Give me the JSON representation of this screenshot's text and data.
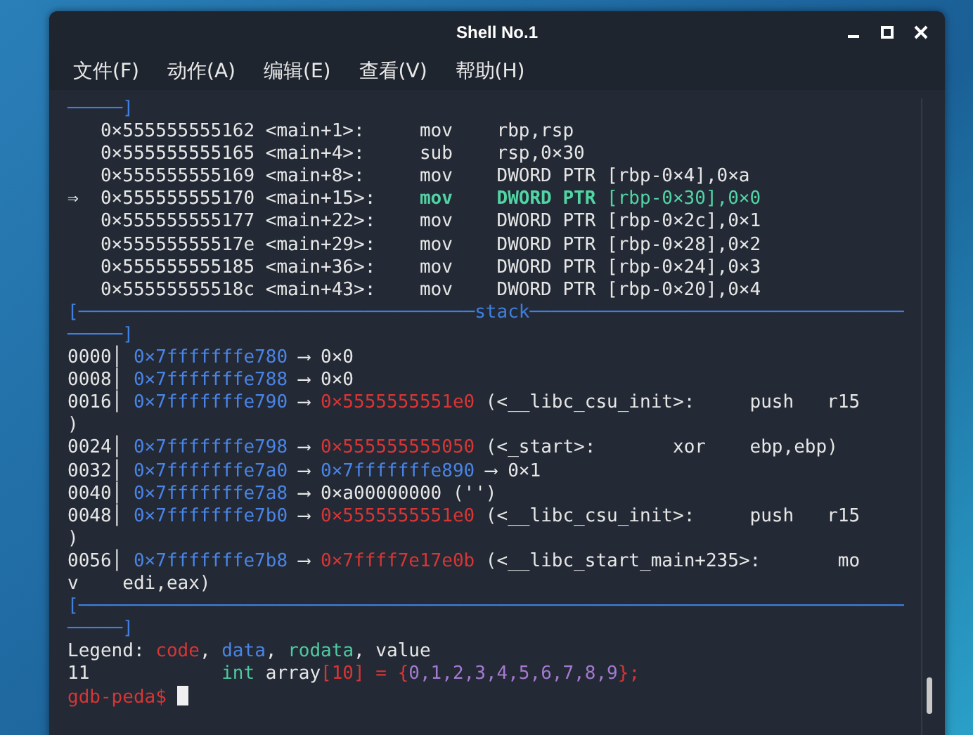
{
  "window": {
    "title": "Shell No.1"
  },
  "menu": [
    "文件(F)",
    "动作(A)",
    "编辑(E)",
    "查看(V)",
    "帮助(H)"
  ],
  "terminal_lines": [
    [
      {
        "text": "─────]",
        "kind": "frame"
      }
    ],
    [
      {
        "text": "   0×555555555162 <main+1>:     mov    rbp,rsp",
        "kind": "plain"
      }
    ],
    [
      {
        "text": "   0×555555555165 <main+4>:     sub    rsp,0×30",
        "kind": "plain"
      }
    ],
    [
      {
        "text": "   0×555555555169 <main+8>:     mov    DWORD PTR [rbp-0×4],0×a",
        "kind": "plain"
      }
    ],
    [
      {
        "text": "⇒  0×555555555170 <main+15>:    ",
        "kind": "plain"
      },
      {
        "text": "mov    DWORD PTR ",
        "kind": "current"
      },
      {
        "text": "[rbp-0×30],0×0",
        "kind": "current_operand"
      }
    ],
    [
      {
        "text": "   0×555555555177 <main+22>:    mov    DWORD PTR [rbp-0×2c],0×1",
        "kind": "plain"
      }
    ],
    [
      {
        "text": "   0×55555555517e <main+29>:    mov    DWORD PTR [rbp-0×28],0×2",
        "kind": "plain"
      }
    ],
    [
      {
        "text": "   0×555555555185 <main+36>:    mov    DWORD PTR [rbp-0×24],0×3",
        "kind": "plain"
      }
    ],
    [
      {
        "text": "   0×55555555518c <main+43>:    mov    DWORD PTR [rbp-0×20],0×4",
        "kind": "plain"
      }
    ],
    [
      {
        "text": "[────────────────────────────────────",
        "kind": "frame"
      },
      {
        "text": "stack",
        "kind": "frame"
      },
      {
        "text": "──────────────────────────────────",
        "kind": "frame"
      }
    ],
    [
      {
        "text": "─────]",
        "kind": "frame"
      }
    ],
    [
      {
        "text": "0000│ ",
        "kind": "plain"
      },
      {
        "text": "0×7fffffffe780",
        "kind": "data"
      },
      {
        "text": " ⟶ 0×0",
        "kind": "plain"
      }
    ],
    [
      {
        "text": "0008│ ",
        "kind": "plain"
      },
      {
        "text": "0×7fffffffe788",
        "kind": "data"
      },
      {
        "text": " ⟶ 0×0",
        "kind": "plain"
      }
    ],
    [
      {
        "text": "0016│ ",
        "kind": "plain"
      },
      {
        "text": "0×7fffffffe790",
        "kind": "data"
      },
      {
        "text": " ⟶ ",
        "kind": "plain"
      },
      {
        "text": "0×5555555551e0",
        "kind": "code"
      },
      {
        "text": " (<__libc_csu_init>:     push   r15",
        "kind": "plain"
      }
    ],
    [
      {
        "text": ")",
        "kind": "plain"
      }
    ],
    [
      {
        "text": "0024│ ",
        "kind": "plain"
      },
      {
        "text": "0×7fffffffe798",
        "kind": "data"
      },
      {
        "text": " ⟶ ",
        "kind": "plain"
      },
      {
        "text": "0×555555555050",
        "kind": "code"
      },
      {
        "text": " (<_start>:       xor    ebp,ebp)",
        "kind": "plain"
      }
    ],
    [
      {
        "text": "0032│ ",
        "kind": "plain"
      },
      {
        "text": "0×7fffffffe7a0",
        "kind": "data"
      },
      {
        "text": " ⟶ ",
        "kind": "plain"
      },
      {
        "text": "0×7fffffffe890",
        "kind": "data"
      },
      {
        "text": " ⟶ 0×1",
        "kind": "plain"
      }
    ],
    [
      {
        "text": "0040│ ",
        "kind": "plain"
      },
      {
        "text": "0×7fffffffe7a8",
        "kind": "data"
      },
      {
        "text": " ⟶ 0×a00000000 ('')",
        "kind": "plain"
      }
    ],
    [
      {
        "text": "0048│ ",
        "kind": "plain"
      },
      {
        "text": "0×7fffffffe7b0",
        "kind": "data"
      },
      {
        "text": " ⟶ ",
        "kind": "plain"
      },
      {
        "text": "0×5555555551e0",
        "kind": "code"
      },
      {
        "text": " (<__libc_csu_init>:     push   r15",
        "kind": "plain"
      }
    ],
    [
      {
        "text": ")",
        "kind": "plain"
      }
    ],
    [
      {
        "text": "0056│ ",
        "kind": "plain"
      },
      {
        "text": "0×7fffffffe7b8",
        "kind": "data"
      },
      {
        "text": " ⟶ ",
        "kind": "plain"
      },
      {
        "text": "0×7ffff7e17e0b",
        "kind": "code"
      },
      {
        "text": " (<__libc_start_main+235>:       mo",
        "kind": "plain"
      }
    ],
    [
      {
        "text": "v    edi,eax)",
        "kind": "plain"
      }
    ],
    [
      {
        "text": "[───────────────────────────────────────────────────────────────────────────",
        "kind": "frame"
      }
    ],
    [
      {
        "text": "─────]",
        "kind": "frame"
      }
    ],
    [
      {
        "text": "Legend: ",
        "kind": "plain"
      },
      {
        "text": "code",
        "kind": "code"
      },
      {
        "text": ", ",
        "kind": "plain"
      },
      {
        "text": "data",
        "kind": "data"
      },
      {
        "text": ", ",
        "kind": "plain"
      },
      {
        "text": "rodata",
        "kind": "rodata"
      },
      {
        "text": ", value",
        "kind": "plain"
      }
    ],
    [
      {
        "text": "11            ",
        "kind": "plain"
      },
      {
        "text": "int",
        "kind": "rodata"
      },
      {
        "text": " array",
        "kind": "plain"
      },
      {
        "text": "[10] = {",
        "kind": "code"
      },
      {
        "text": "0,1,2,3,4,5,6,7,8,9",
        "kind": "number"
      },
      {
        "text": "};",
        "kind": "code"
      }
    ],
    [
      {
        "text": "gdb-peda$ ",
        "kind": "code"
      }
    ]
  ]
}
